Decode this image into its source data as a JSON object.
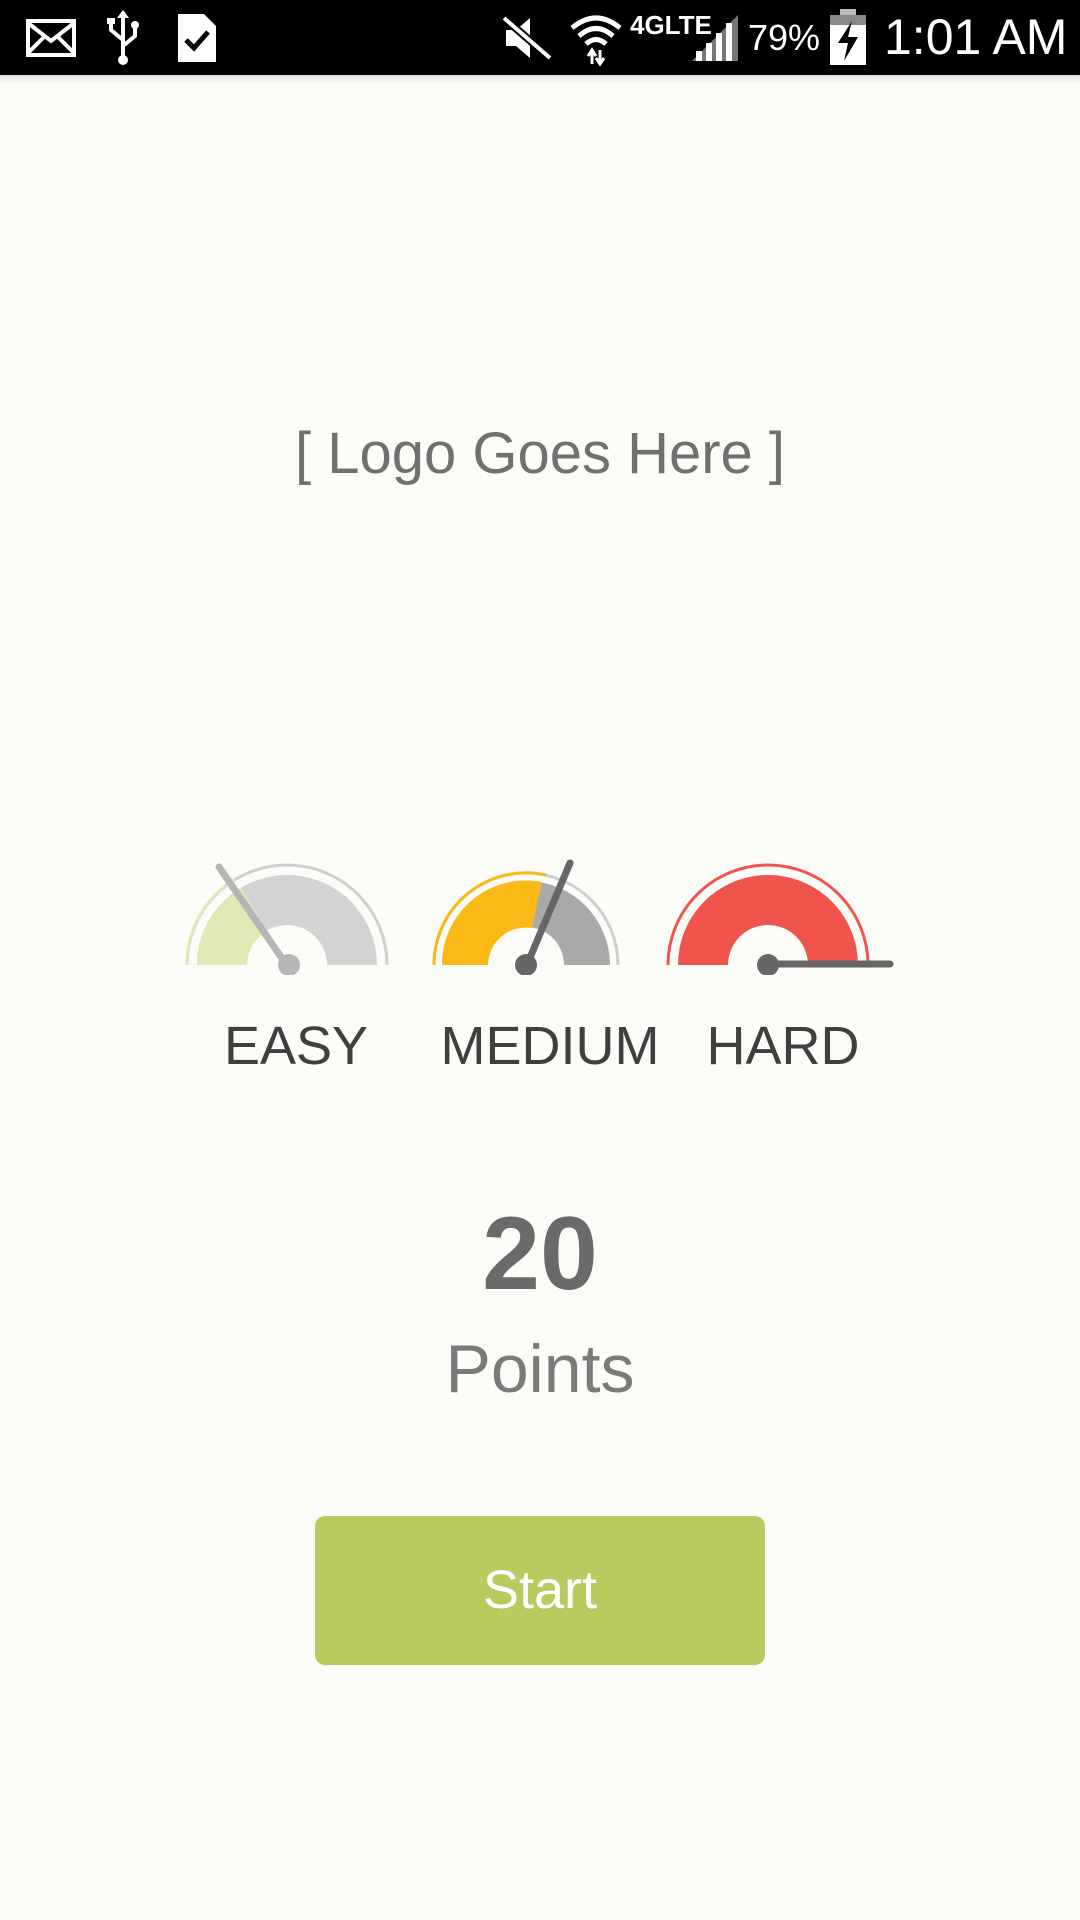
{
  "status_bar": {
    "battery": "79%",
    "time": "1:01 AM",
    "network": "4GLTE",
    "icons": [
      "mail-icon",
      "usb-icon",
      "task-icon",
      "mute-icon",
      "wifi-icon",
      "signal-icon",
      "battery-charging-icon"
    ]
  },
  "logo_placeholder": "[ Logo Goes Here ]",
  "difficulty": {
    "options": [
      {
        "label": "EASY",
        "icon": "gauge-easy-icon",
        "color": "#dfe9b4"
      },
      {
        "label": "MEDIUM",
        "icon": "gauge-medium-icon",
        "color": "#fbb917"
      },
      {
        "label": "HARD",
        "icon": "gauge-hard-icon",
        "color": "#f0554d"
      }
    ]
  },
  "score": {
    "value": "20",
    "unit": "Points"
  },
  "start_button": {
    "label": "Start",
    "color": "#b8cb5f"
  }
}
